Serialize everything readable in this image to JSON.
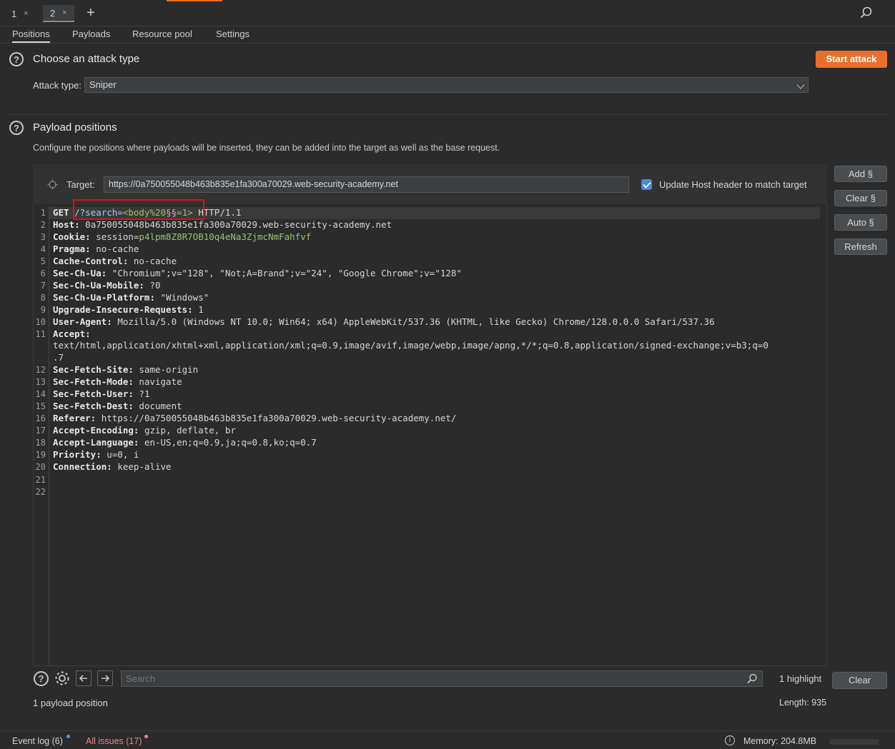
{
  "request_tabs": [
    {
      "label": "1",
      "close": "×"
    },
    {
      "label": "2",
      "close": "×"
    }
  ],
  "add_tab": "+",
  "sub_tabs": [
    "Positions",
    "Payloads",
    "Resource pool",
    "Settings"
  ],
  "attack_section": {
    "help": "?",
    "title": "Choose an attack type",
    "start_attack": "Start attack",
    "attack_type_label": "Attack type:",
    "attack_type_value": "Sniper"
  },
  "payload_section": {
    "help": "?",
    "title": "Payload positions",
    "description": "Configure the positions where payloads will be inserted, they can be added into the target as well as the base request.",
    "target_label": "Target:",
    "target_value": "https://0a750055048b463b835e1fa300a70029.web-security-academy.net",
    "update_host_label": "Update Host header to match target",
    "side_buttons": [
      "Add §",
      "Clear §",
      "Auto §",
      "Refresh"
    ]
  },
  "request": {
    "line1": {
      "method": "GET ",
      "path_a": "/?search=",
      "path_b": "<body%20",
      "marker": "§§",
      "path_c": "=1>",
      "proto": " HTTP/1.1"
    },
    "headers": [
      {
        "n": "2",
        "k": "Host:",
        "v": " 0a750055048b463b835e1fa300a70029.web-security-academy.net"
      },
      {
        "n": "3",
        "k": "Cookie:",
        "v": " session=",
        "v2": "p4lpm8Z8R7OB10q4eNa3ZjmcNmFahfvf"
      },
      {
        "n": "4",
        "k": "Pragma:",
        "v": " no-cache"
      },
      {
        "n": "5",
        "k": "Cache-Control:",
        "v": " no-cache"
      },
      {
        "n": "6",
        "k": "Sec-Ch-Ua:",
        "v": " \"Chromium\";v=\"128\", \"Not;A=Brand\";v=\"24\", \"Google Chrome\";v=\"128\""
      },
      {
        "n": "7",
        "k": "Sec-Ch-Ua-Mobile:",
        "v": " ?0"
      },
      {
        "n": "8",
        "k": "Sec-Ch-Ua-Platform:",
        "v": " \"Windows\""
      },
      {
        "n": "9",
        "k": "Upgrade-Insecure-Requests:",
        "v": " 1"
      },
      {
        "n": "10",
        "k": "User-Agent:",
        "v": " Mozilla/5.0 (Windows NT 10.0; Win64; x64) AppleWebKit/537.36 (KHTML, like Gecko) Chrome/128.0.0.0 Safari/537.36"
      },
      {
        "n": "11",
        "k": "Accept:",
        "v": ""
      }
    ],
    "accept_wrap1": "text/html,application/xhtml+xml,application/xml;q=0.9,image/avif,image/webp,image/apng,*/*;q=0.8,application/signed-exchange;v=b3;q=0",
    "accept_wrap2": ".7",
    "headers2": [
      {
        "n": "12",
        "k": "Sec-Fetch-Site:",
        "v": " same-origin"
      },
      {
        "n": "13",
        "k": "Sec-Fetch-Mode:",
        "v": " navigate"
      },
      {
        "n": "14",
        "k": "Sec-Fetch-User:",
        "v": " ?1"
      },
      {
        "n": "15",
        "k": "Sec-Fetch-Dest:",
        "v": " document"
      },
      {
        "n": "16",
        "k": "Referer:",
        "v": " https://0a750055048b463b835e1fa300a70029.web-security-academy.net/"
      },
      {
        "n": "17",
        "k": "Accept-Encoding:",
        "v": " gzip, deflate, br"
      },
      {
        "n": "18",
        "k": "Accept-Language:",
        "v": " en-US,en;q=0.9,ja;q=0.8,ko;q=0.7"
      },
      {
        "n": "19",
        "k": "Priority:",
        "v": " u=0, i"
      },
      {
        "n": "20",
        "k": "Connection:",
        "v": " keep-alive"
      }
    ],
    "empty_lines": [
      "21",
      "22"
    ],
    "first_line_number": "1"
  },
  "editor_footer": {
    "search_placeholder": "Search",
    "highlights": "1 highlight",
    "clear": "Clear",
    "payload_positions": "1 payload position",
    "length": "Length: 935"
  },
  "status_bar": {
    "event_log": "Event log (6)",
    "all_issues": "All issues (17)",
    "info": "i",
    "memory": "Memory: 204.8MB"
  },
  "colors": {
    "accent": "#e8702a",
    "issues": "#e8848c",
    "event_dot": "#4a9ee0",
    "issue_dot": "#e8848c"
  }
}
